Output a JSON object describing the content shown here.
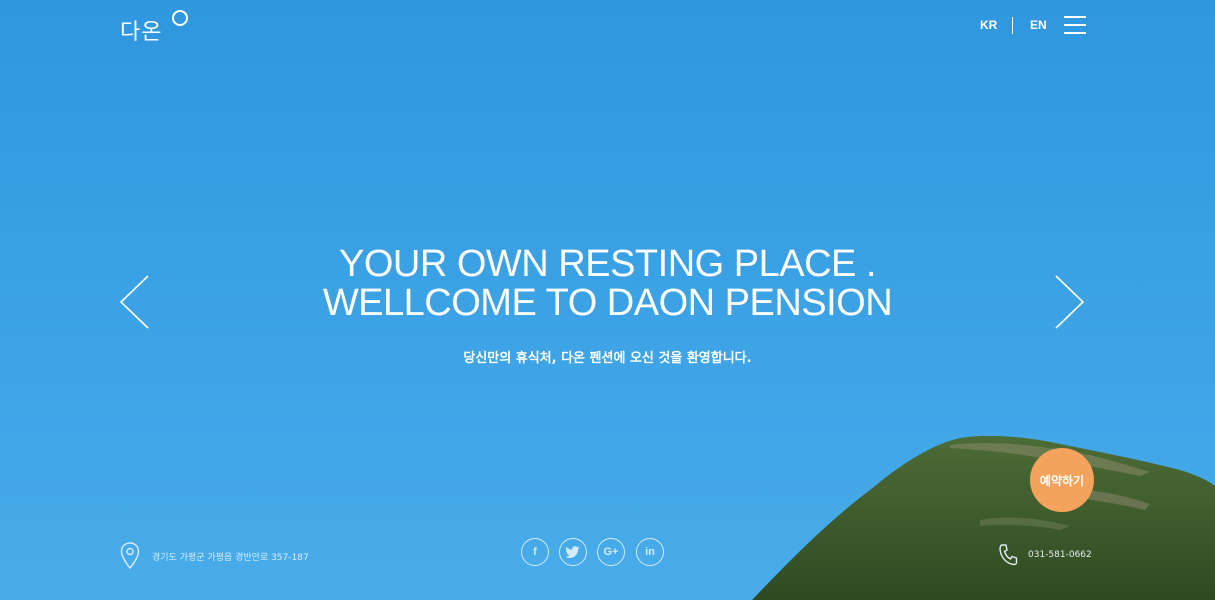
{
  "header": {
    "logo_text": "다온",
    "lang": {
      "kr": "KR",
      "en": "EN"
    },
    "menu_icon": "hamburger-menu-icon"
  },
  "hero": {
    "title_line1": "YOUR OWN RESTING PLACE .",
    "title_line2": "WELLCOME TO DAON PENSION",
    "subtitle": "당신만의 휴식처, 다온 펜션에 오신 것을 환영합니다.",
    "prev_icon": "chevron-left-icon",
    "next_icon": "chevron-right-icon",
    "reserve_label": "예약하기"
  },
  "footer": {
    "address": "경기도 가평군 가평읍 경반안로 357-187",
    "address_icon": "location-pin-icon",
    "social": [
      {
        "label": "f",
        "icon": "facebook-icon"
      },
      {
        "label": "twitter",
        "icon": "twitter-icon"
      },
      {
        "label": "G+",
        "icon": "google-plus-icon"
      },
      {
        "label": "in",
        "icon": "linkedin-icon"
      }
    ],
    "phone": "031-581-0662",
    "phone_icon": "phone-icon"
  },
  "colors": {
    "sky": "#3aa1e4",
    "mountain": "#3e5b2c",
    "reserve_button": "#f4a35d",
    "text": "#ffffff"
  }
}
